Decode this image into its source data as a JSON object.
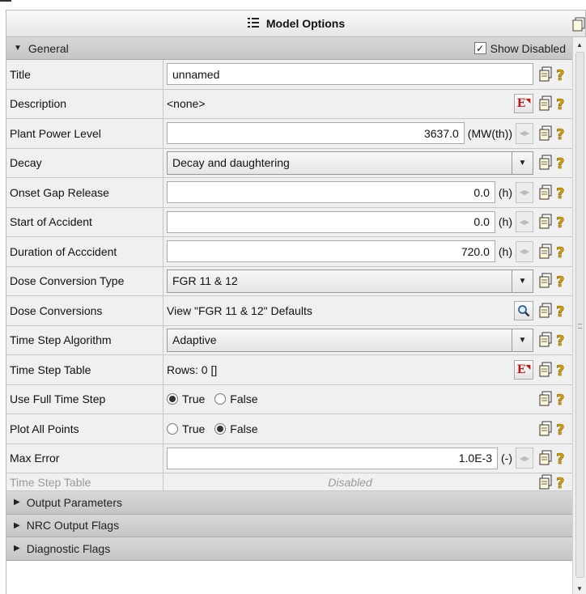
{
  "window": {
    "title": "Model Options"
  },
  "general": {
    "header": "General",
    "show_disabled_label": "Show Disabled",
    "show_disabled_checked": true,
    "rows": {
      "title": {
        "label": "Title",
        "value": "unnamed"
      },
      "description": {
        "label": "Description",
        "value": "<none>"
      },
      "plant_power_level": {
        "label": "Plant Power Level",
        "value": "3637.0",
        "unit": "(MW(th))"
      },
      "decay": {
        "label": "Decay",
        "value": "Decay and daughtering"
      },
      "onset_gap_release": {
        "label": "Onset Gap Release",
        "value": "0.0",
        "unit": "(h)"
      },
      "start_of_accident": {
        "label": "Start of Accident",
        "value": "0.0",
        "unit": "(h)"
      },
      "duration_of_accident": {
        "label": "Duration of Acccident",
        "value": "720.0",
        "unit": "(h)"
      },
      "dose_conversion_type": {
        "label": "Dose Conversion Type",
        "value": "FGR 11 & 12"
      },
      "dose_conversions": {
        "label": "Dose Conversions",
        "value": "View \"FGR 11 & 12\" Defaults"
      },
      "time_step_algorithm": {
        "label": "Time Step Algorithm",
        "value": "Adaptive"
      },
      "time_step_table": {
        "label": "Time Step Table",
        "value": "Rows: 0 []"
      },
      "use_full_time_step": {
        "label": "Use Full Time Step",
        "true_label": "True",
        "false_label": "False",
        "selected": "True"
      },
      "plot_all_points": {
        "label": "Plot All Points",
        "true_label": "True",
        "false_label": "False",
        "selected": "False"
      },
      "max_error": {
        "label": "Max Error",
        "value": "1.0E-3",
        "unit": "(-)"
      },
      "time_step_table_disabled": {
        "label": "Time Step Table",
        "value": "Disabled"
      }
    }
  },
  "collapsed_sections": {
    "output_parameters": "Output Parameters",
    "nrc_output_flags": "NRC Output Flags",
    "diagnostic_flags": "Diagnostic Flags"
  },
  "icons": {
    "row_doc": "copy-doc-icon",
    "row_help": "help-icon",
    "edit": "edit-E-icon",
    "search": "search-icon"
  },
  "colors": {
    "header_bg": "#cfcfcf",
    "help_icon": "#d9a400",
    "edit_icon": "#c01818"
  }
}
